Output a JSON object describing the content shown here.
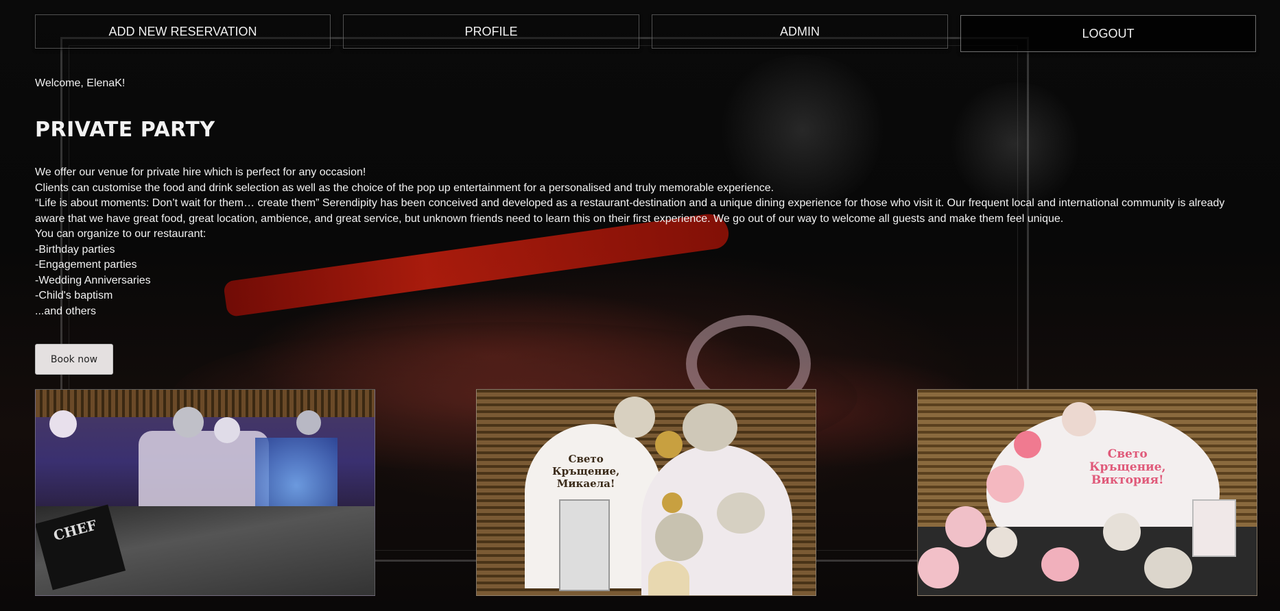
{
  "nav": {
    "add_reservation": "ADD NEW RESERVATION",
    "profile": "PROFILE",
    "admin": "ADMIN",
    "logout": "LOGOUT"
  },
  "welcome": "Welcome, ElenaK!",
  "title": "PRIVATE PARTY",
  "paragraphs": [
    "We offer our venue for private hire which is perfect for any occasion!",
    "Clients can customise the food and drink selection as well as the choice of the pop up entertainment for a personalised and truly memorable experience.",
    "“Life is about moments: Don’t wait for them… create them” Serendipity has been conceived and developed as a restaurant-destination and a unique dining experience for those who visit it. Our frequent local and international community is already aware that we have great food, great location, ambience, and great service, but unknown friends need to learn this on their first experience. We go out of our way to welcome all guests and make them feel unique.",
    "You can organize to our restaurant:",
    "-Birthday parties",
    "-Engagement parties",
    "-Wedding Anniversaries",
    "-Child's baptism",
    "...and others"
  ],
  "book_button": "Book now",
  "photos": {
    "photo1_sign": "CHEF",
    "photo2_sign": [
      "Свето",
      "Кръщение,",
      "Микаела!"
    ],
    "photo3_sign": [
      "Свето",
      "Кръщение,",
      "Виктория!"
    ]
  },
  "colors": {
    "background": "#050505",
    "button_bg": "#e4e0e0",
    "text": "#f2f2f2",
    "accent_pepper": "#d0200e"
  }
}
